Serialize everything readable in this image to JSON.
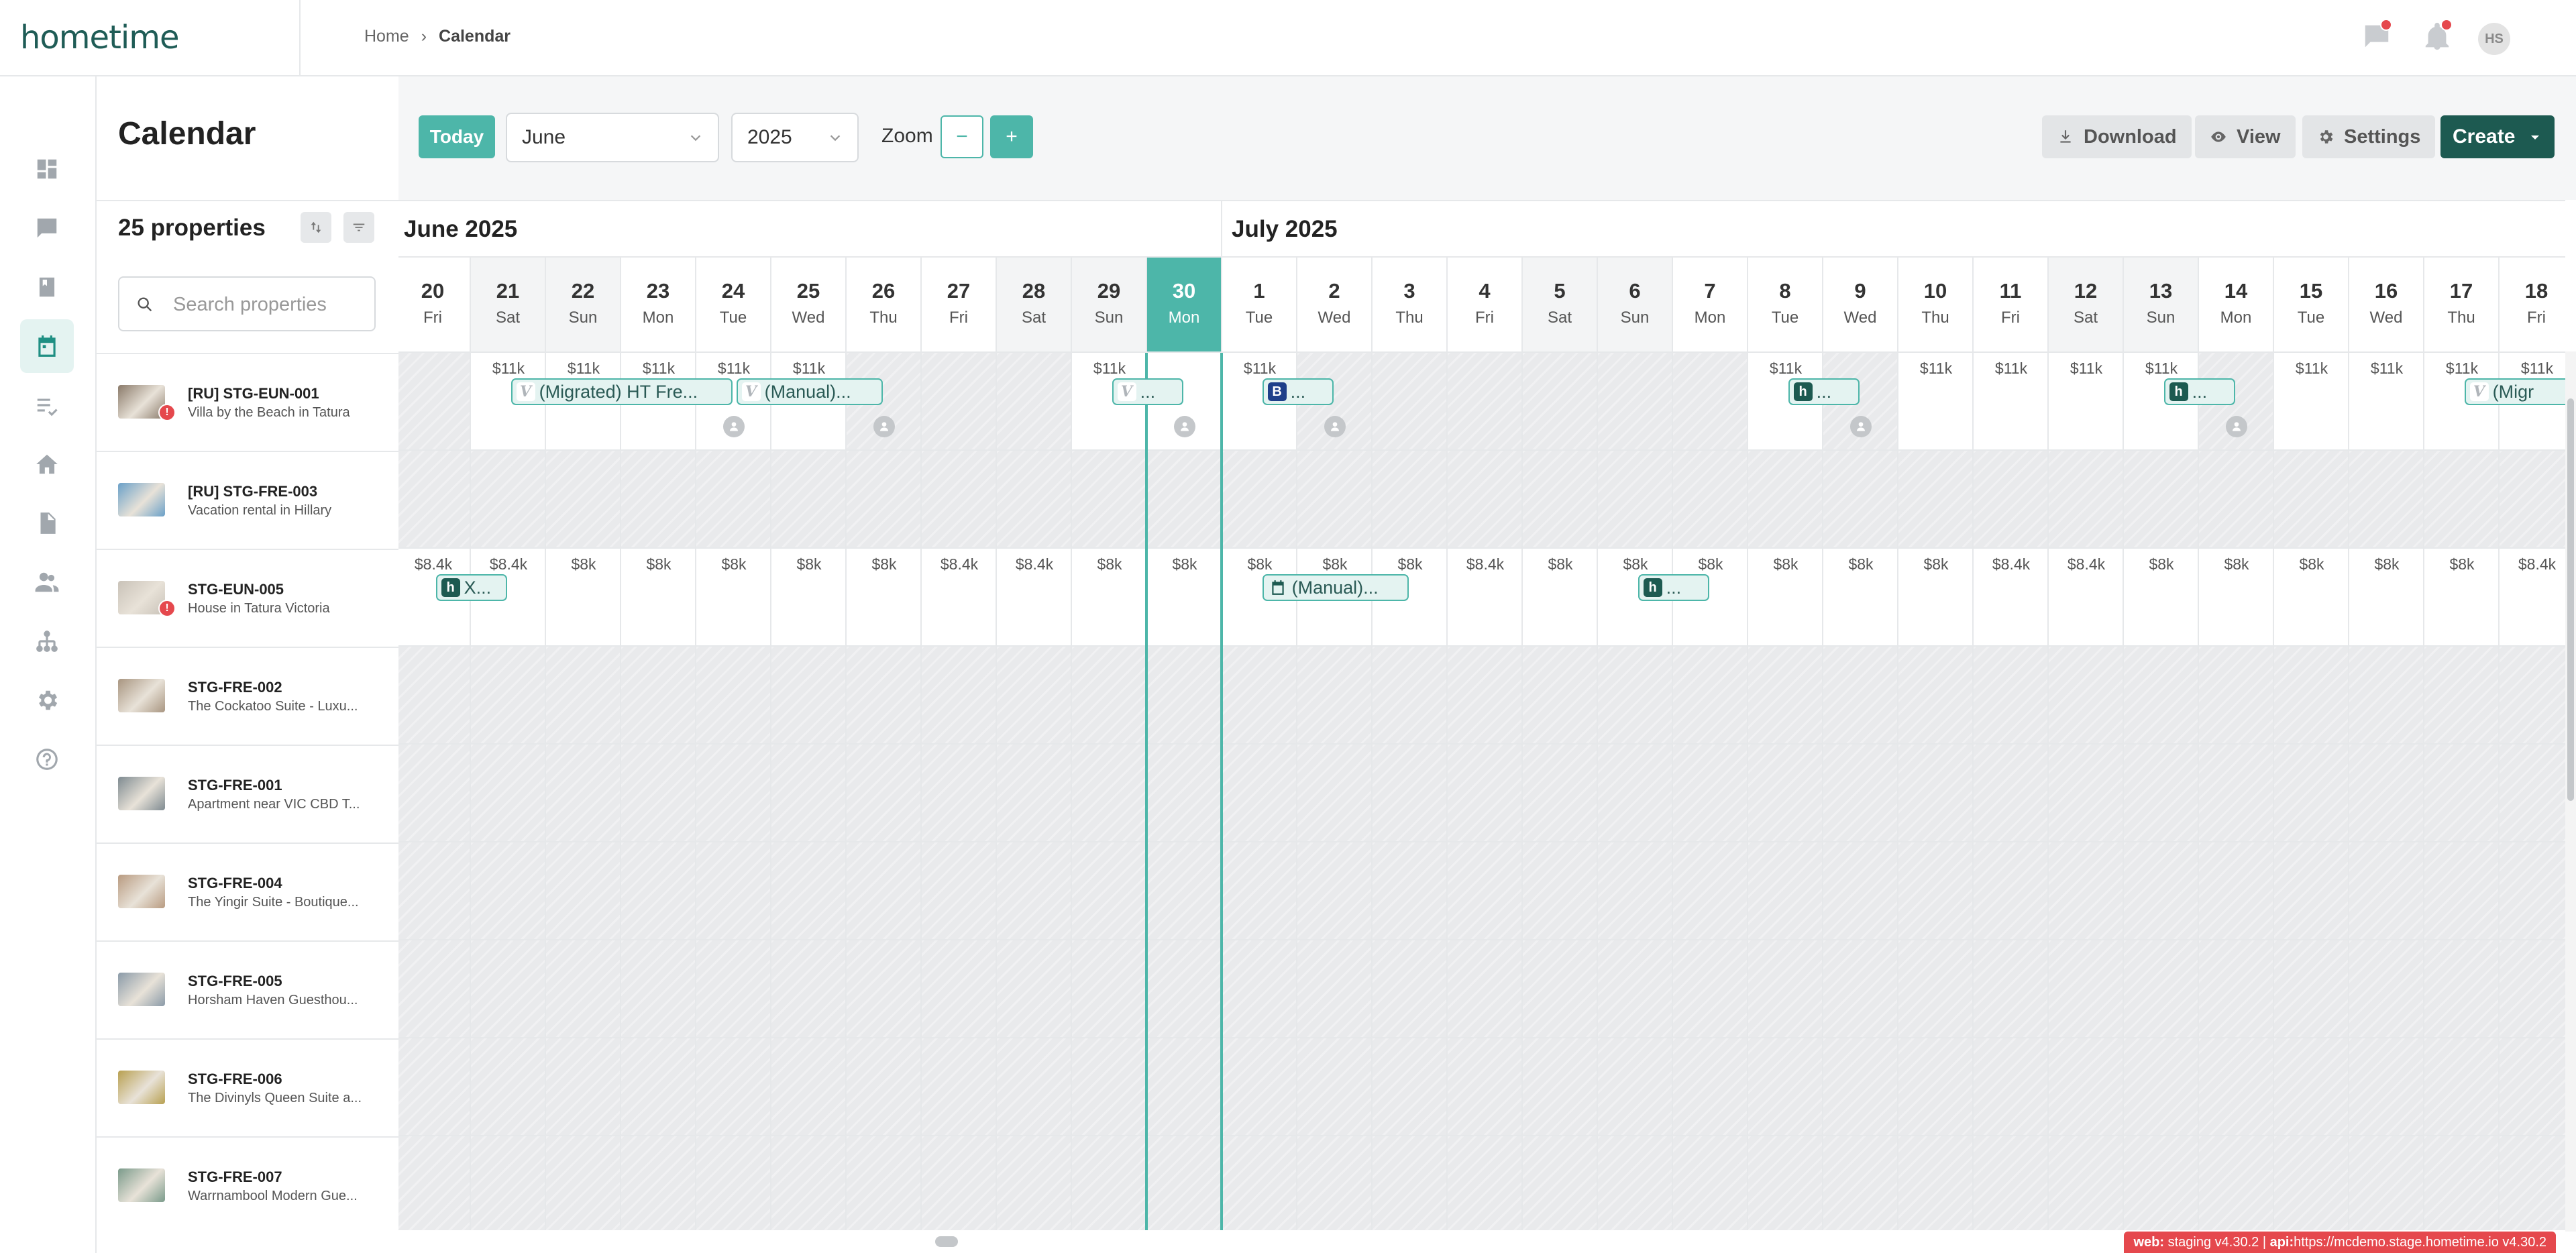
{
  "app": {
    "logo": "hometime",
    "version_env_label": "web:",
    "version_env": "staging v4.30.2",
    "version_api_label": "api:",
    "version_api": "https://mcdemo.stage.hometime.io v4.30.2"
  },
  "breadcrumb": {
    "home": "Home",
    "separator": "›",
    "current": "Calendar"
  },
  "user": {
    "initials": "HS"
  },
  "page": {
    "title": "Calendar"
  },
  "toolbar": {
    "today_label": "Today",
    "month_value": "June",
    "year_value": "2025",
    "zoom_label": "Zoom",
    "zoom_out": "−",
    "zoom_in": "+",
    "download_label": "Download",
    "view_label": "View",
    "settings_label": "Settings",
    "create_label": "Create"
  },
  "sidebar_nav": [
    "dashboard-icon",
    "messages-icon",
    "book-icon",
    "calendar-icon",
    "tasks-icon",
    "home-icon",
    "document-icon",
    "people-icon",
    "network-icon",
    "gear-icon",
    "help-icon"
  ],
  "properties": {
    "count_label": "25 properties",
    "search_placeholder": "Search properties",
    "items": [
      {
        "code": "[RU] STG-EUN-001",
        "name": "Villa by the Beach in Tatura",
        "warn": "!",
        "thumb": "#8a7a6a"
      },
      {
        "code": "[RU] STG-FRE-003",
        "name": "Vacation rental in Hillary",
        "warn": "",
        "thumb": "#6aa0c8"
      },
      {
        "code": "STG-EUN-005",
        "name": "House in Tatura Victoria",
        "warn": "!",
        "thumb": "#c9c2b8"
      },
      {
        "code": "STG-FRE-002",
        "name": "The Cockatoo Suite - Luxu...",
        "warn": "",
        "thumb": "#a89580"
      },
      {
        "code": "STG-FRE-001",
        "name": "Apartment near VIC CBD T...",
        "warn": "",
        "thumb": "#7e8a90"
      },
      {
        "code": "STG-FRE-004",
        "name": "The Yingir Suite - Boutique...",
        "warn": "",
        "thumb": "#b89a80"
      },
      {
        "code": "STG-FRE-005",
        "name": "Horsham Haven Guesthou...",
        "warn": "",
        "thumb": "#8a9aa8"
      },
      {
        "code": "STG-FRE-006",
        "name": "The Divinyls Queen Suite a...",
        "warn": "",
        "thumb": "#b8a050"
      },
      {
        "code": "STG-FRE-007",
        "name": "Warrnambool Modern Gue...",
        "warn": "",
        "thumb": "#7a9a8a"
      }
    ]
  },
  "calendar": {
    "months": [
      {
        "label": "June 2025"
      },
      {
        "label": "July 2025"
      }
    ],
    "days": [
      {
        "num": "20",
        "name": "Fri",
        "weekend": false
      },
      {
        "num": "21",
        "name": "Sat",
        "weekend": true
      },
      {
        "num": "22",
        "name": "Sun",
        "weekend": true
      },
      {
        "num": "23",
        "name": "Mon",
        "weekend": false
      },
      {
        "num": "24",
        "name": "Tue",
        "weekend": false
      },
      {
        "num": "25",
        "name": "Wed",
        "weekend": false
      },
      {
        "num": "26",
        "name": "Thu",
        "weekend": false
      },
      {
        "num": "27",
        "name": "Fri",
        "weekend": false
      },
      {
        "num": "28",
        "name": "Sat",
        "weekend": true
      },
      {
        "num": "29",
        "name": "Sun",
        "weekend": true
      },
      {
        "num": "30",
        "name": "Mon",
        "weekend": false,
        "today": true
      },
      {
        "num": "1",
        "name": "Tue",
        "weekend": false
      },
      {
        "num": "2",
        "name": "Wed",
        "weekend": false
      },
      {
        "num": "3",
        "name": "Thu",
        "weekend": false
      },
      {
        "num": "4",
        "name": "Fri",
        "weekend": false
      },
      {
        "num": "5",
        "name": "Sat",
        "weekend": true
      },
      {
        "num": "6",
        "name": "Sun",
        "weekend": true
      },
      {
        "num": "7",
        "name": "Mon",
        "weekend": false
      },
      {
        "num": "8",
        "name": "Tue",
        "weekend": false
      },
      {
        "num": "9",
        "name": "Wed",
        "weekend": false
      },
      {
        "num": "10",
        "name": "Thu",
        "weekend": false
      },
      {
        "num": "11",
        "name": "Fri",
        "weekend": false
      },
      {
        "num": "12",
        "name": "Sat",
        "weekend": true
      },
      {
        "num": "13",
        "name": "Sun",
        "weekend": true
      },
      {
        "num": "14",
        "name": "Mon",
        "weekend": false
      },
      {
        "num": "15",
        "name": "Tue",
        "weekend": false
      },
      {
        "num": "16",
        "name": "Wed",
        "weekend": false
      },
      {
        "num": "17",
        "name": "Thu",
        "weekend": false
      },
      {
        "num": "18",
        "name": "Fri",
        "weekend": false
      }
    ],
    "rows": [
      {
        "blocked": [
          0,
          6,
          7,
          8,
          12,
          13,
          14,
          15,
          16,
          17,
          19,
          24
        ],
        "prices": [
          "",
          "$11k",
          "$11k",
          "$11k",
          "$11k",
          "$11k",
          "",
          "",
          "",
          "$11k",
          "",
          "$11k",
          "",
          "",
          "",
          "",
          "",
          "",
          "$11k",
          "",
          "$11k",
          "$11k",
          "$11k",
          "$11k",
          "",
          "$11k",
          "$11k",
          "$11k",
          "$11k"
        ],
        "checkins": [
          4,
          6,
          10,
          12,
          19,
          24
        ]
      },
      {
        "blocked": "all",
        "prices": [],
        "checkins": []
      },
      {
        "blocked": [],
        "prices": [
          "$8.4k",
          "$8.4k",
          "$8k",
          "$8k",
          "$8k",
          "$8k",
          "$8k",
          "$8.4k",
          "$8.4k",
          "$8k",
          "$8k",
          "$8k",
          "$8k",
          "$8k",
          "$8.4k",
          "$8k",
          "$8k",
          "$8k",
          "$8k",
          "$8k",
          "$8k",
          "$8.4k",
          "$8.4k",
          "$8k",
          "$8k",
          "$8k",
          "$8k",
          "$8k",
          "$8.4k"
        ],
        "checkins": []
      },
      {
        "blocked": "all",
        "prices": [],
        "checkins": []
      },
      {
        "blocked": "all",
        "prices": [],
        "checkins": []
      },
      {
        "blocked": "all",
        "prices": [],
        "checkins": []
      },
      {
        "blocked": "all",
        "prices": [],
        "checkins": []
      },
      {
        "blocked": "all",
        "prices": [],
        "checkins": []
      },
      {
        "blocked": "all",
        "prices": [],
        "checkins": []
      }
    ],
    "bookings": [
      {
        "row": 0,
        "start": 1.55,
        "span": 2.95,
        "channel": "vrbo",
        "glyph": "V",
        "label": "(Migrated) HT Fre..."
      },
      {
        "row": 0,
        "start": 4.55,
        "span": 1.95,
        "channel": "vrbo",
        "glyph": "V",
        "label": "(Manual)..."
      },
      {
        "row": 0,
        "start": 9.55,
        "span": 0.95,
        "channel": "vrbo",
        "glyph": "V",
        "label": "..."
      },
      {
        "row": 0,
        "start": 11.55,
        "span": 0.95,
        "channel": "booking",
        "glyph": "B",
        "label": "..."
      },
      {
        "row": 0,
        "start": 18.55,
        "span": 0.95,
        "channel": "hometime",
        "glyph": "h",
        "label": "..."
      },
      {
        "row": 0,
        "start": 23.55,
        "span": 0.95,
        "channel": "hometime",
        "glyph": "h",
        "label": "..."
      },
      {
        "row": 0,
        "start": 27.55,
        "span": 1.6,
        "channel": "vrbo",
        "glyph": "V",
        "label": "(Migr"
      },
      {
        "row": 2,
        "start": 0.55,
        "span": 0.95,
        "channel": "hometime",
        "glyph": "h",
        "label": "X..."
      },
      {
        "row": 2,
        "start": 11.55,
        "span": 1.95,
        "channel": "manualcal",
        "glyph": "",
        "label": "(Manual)..."
      },
      {
        "row": 2,
        "start": 16.55,
        "span": 0.95,
        "channel": "hometime",
        "glyph": "h",
        "label": "..."
      }
    ]
  }
}
